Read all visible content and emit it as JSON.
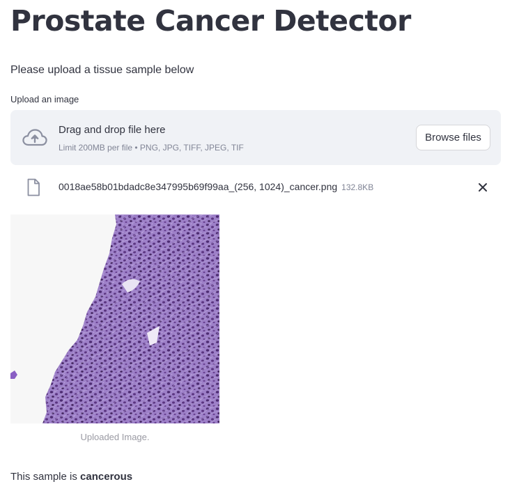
{
  "app": {
    "title": "Prostate Cancer Detector",
    "intro": "Please upload a tissue sample below"
  },
  "uploader": {
    "label": "Upload an image",
    "drop_text": "Drag and drop file here",
    "limit_text": "Limit 200MB per file • PNG, JPG, TIFF, JPEG, TIF",
    "browse_label": "Browse files",
    "icon": "cloud-upload-icon"
  },
  "uploaded_file": {
    "name": "0018ae58b01bdadc8e347995b69f99aa_(256, 1024)_cancer.png",
    "size": "132.8KB",
    "file_icon": "file-icon",
    "remove_icon": "close-icon"
  },
  "image": {
    "caption": "Uploaded Image."
  },
  "result": {
    "prefix": "This sample is ",
    "verdict": "cancerous"
  },
  "colors": {
    "text": "#31333f",
    "muted": "#808495",
    "dropzone_bg": "#f0f2f6",
    "tissue_stroma": "#a78bcf",
    "tissue_nuclei": "#4a2a6e"
  }
}
